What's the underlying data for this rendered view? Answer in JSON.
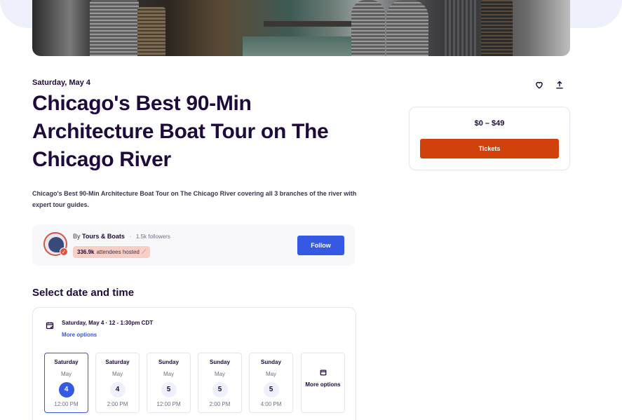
{
  "event": {
    "date_label": "Saturday, May 4",
    "title": "Chicago's Best 90-Min Architecture Boat Tour on The Chicago River",
    "summary": "Chicago's Best 90-Min Architecture Boat Tour on The Chicago River covering all 3 branches of the river with expert tour guides."
  },
  "actions": {
    "like_icon": "heart-icon",
    "share_icon": "share-icon"
  },
  "tickets": {
    "price_range": "$0 – $49",
    "button_label": "Tickets"
  },
  "organizer": {
    "by_label": "By",
    "name": "Tours & Boats",
    "separator": "·",
    "followers": "1.5k followers",
    "attendees_count": "336.9k",
    "attendees_label": "attendees hosted",
    "follow_label": "Follow"
  },
  "date_time": {
    "section_title": "Select date and time",
    "selected": "Saturday, May 4 · 12 - 1:30pm CDT",
    "more_options_link": "More options",
    "slots": [
      {
        "day": "Saturday",
        "month": "May",
        "date": "4",
        "time": "12:00 PM",
        "selected": true
      },
      {
        "day": "Saturday",
        "month": "May",
        "date": "4",
        "time": "2:00 PM",
        "selected": false
      },
      {
        "day": "Sunday",
        "month": "May",
        "date": "5",
        "time": "12:00 PM",
        "selected": false
      },
      {
        "day": "Sunday",
        "month": "May",
        "date": "5",
        "time": "2:00 PM",
        "selected": false
      },
      {
        "day": "Sunday",
        "month": "May",
        "date": "5",
        "time": "4:00 PM",
        "selected": false
      }
    ],
    "more_options_tile": "More options"
  },
  "colors": {
    "brand_orange": "#d1410c",
    "follow_blue": "#3659e3",
    "title_navy": "#1e0a3c"
  }
}
